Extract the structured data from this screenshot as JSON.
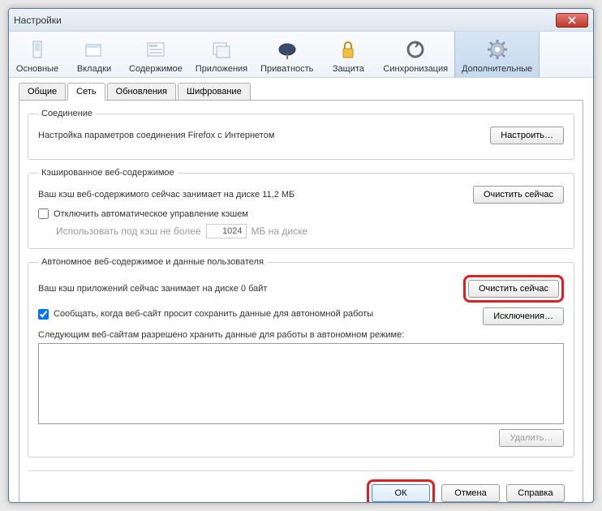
{
  "window": {
    "title": "Настройки"
  },
  "toolbar": {
    "items": [
      {
        "label": "Основные",
        "icon": "general"
      },
      {
        "label": "Вкладки",
        "icon": "tabs"
      },
      {
        "label": "Содержимое",
        "icon": "content"
      },
      {
        "label": "Приложения",
        "icon": "apps"
      },
      {
        "label": "Приватность",
        "icon": "privacy"
      },
      {
        "label": "Защита",
        "icon": "security"
      },
      {
        "label": "Синхронизация",
        "icon": "sync"
      },
      {
        "label": "Дополнительные",
        "icon": "advanced",
        "active": true
      }
    ]
  },
  "tabs": [
    {
      "label": "Общие"
    },
    {
      "label": "Сеть",
      "active": true
    },
    {
      "label": "Обновления"
    },
    {
      "label": "Шифрование"
    }
  ],
  "connection": {
    "legend": "Соединение",
    "text": "Настройка параметров соединения Firefox с Интернетом",
    "button": "Настроить…"
  },
  "cached": {
    "legend": "Кэшированное веб-содержимое",
    "status": "Ваш кэш веб-содержимого сейчас занимает на диске 11,2 МБ",
    "clear": "Очистить сейчас",
    "override_label": "Отключить автоматическое управление кэшем",
    "override_checked": false,
    "limit_prefix": "Использовать под кэш не более",
    "limit_value": "1024",
    "limit_suffix": "МБ на диске"
  },
  "offline": {
    "legend": "Автономное веб-содержимое и данные пользователя",
    "status": "Ваш кэш приложений сейчас занимает на диске 0 байт",
    "clear": "Очистить сейчас",
    "notify_label": "Сообщать, когда веб-сайт просит сохранить данные для автономной работы",
    "notify_checked": true,
    "exceptions": "Исключения…",
    "list_label": "Следующим веб-сайтам разрешено хранить данные для работы в автономном режиме:",
    "remove": "Удалить…"
  },
  "footer": {
    "ok": "ОК",
    "cancel": "Отмена",
    "help": "Справка"
  }
}
